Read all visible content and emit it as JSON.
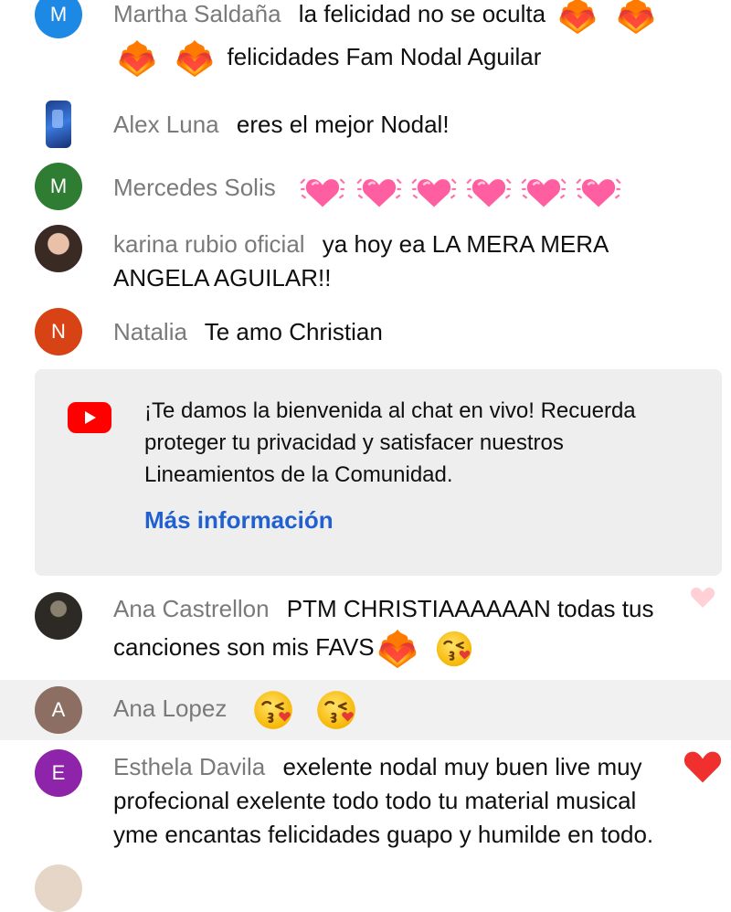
{
  "messages": [
    {
      "author": "Martha Saldaña",
      "avatar_letter": "M",
      "avatar_color": "#1e88e5",
      "line1": "la felicidad no se oculta",
      "line2": "felicidades Fam Nodal Aguilar",
      "emojis": [
        "heart-on-fire",
        "heart-on-fire",
        "heart-on-fire",
        "heart-on-fire"
      ]
    },
    {
      "author": "Alex Luna",
      "avatar_type": "image",
      "text": "eres el mejor Nodal!"
    },
    {
      "author": "Mercedes Solis",
      "avatar_letter": "M",
      "avatar_color": "#2e7d32",
      "emojis": [
        "beating-heart",
        "beating-heart",
        "beating-heart",
        "beating-heart",
        "beating-heart",
        "beating-heart"
      ]
    },
    {
      "author": "karina rubio oficial",
      "avatar_type": "image",
      "line1": "ya hoy ea LA MERA MERA",
      "line2": "ANGELA AGUILAR!!"
    },
    {
      "author": "Natalia",
      "avatar_letter": "N",
      "avatar_color": "#d84315",
      "text": "Te amo Christian"
    },
    {
      "author": "Ana Castrellon",
      "avatar_type": "image",
      "line1": "PTM CHRISTIAAAAAAN todas tus",
      "line2": "canciones son mis FAVS",
      "emojis": [
        "heart-on-fire",
        "face-blowing-kiss"
      ]
    },
    {
      "author": "Ana Lopez",
      "avatar_letter": "A",
      "avatar_color": "#8d6e63",
      "emojis": [
        "face-blowing-kiss",
        "face-blowing-kiss"
      ]
    },
    {
      "author": "Esthela Davila",
      "avatar_letter": "E",
      "avatar_color": "#8e24aa",
      "line1": "exelente nodal muy buen live muy",
      "line2": "profecional exelente todo todo tu material musical",
      "line3": "yme encantas felicidades guapo y humilde en todo."
    }
  ],
  "welcome": {
    "icon": "youtube-logo-icon",
    "line1": "¡Te damos la bienvenida al chat en vivo! Recuerda",
    "line2": "proteger tu privacidad y satisfacer nuestros",
    "line3": "Lineamientos de la Comunidad.",
    "link": "Más información"
  },
  "colors": {
    "author": "#7a7a7a",
    "link": "#2160d0",
    "youtube_red": "#ff0000",
    "highlight": "#f1f1f1"
  }
}
